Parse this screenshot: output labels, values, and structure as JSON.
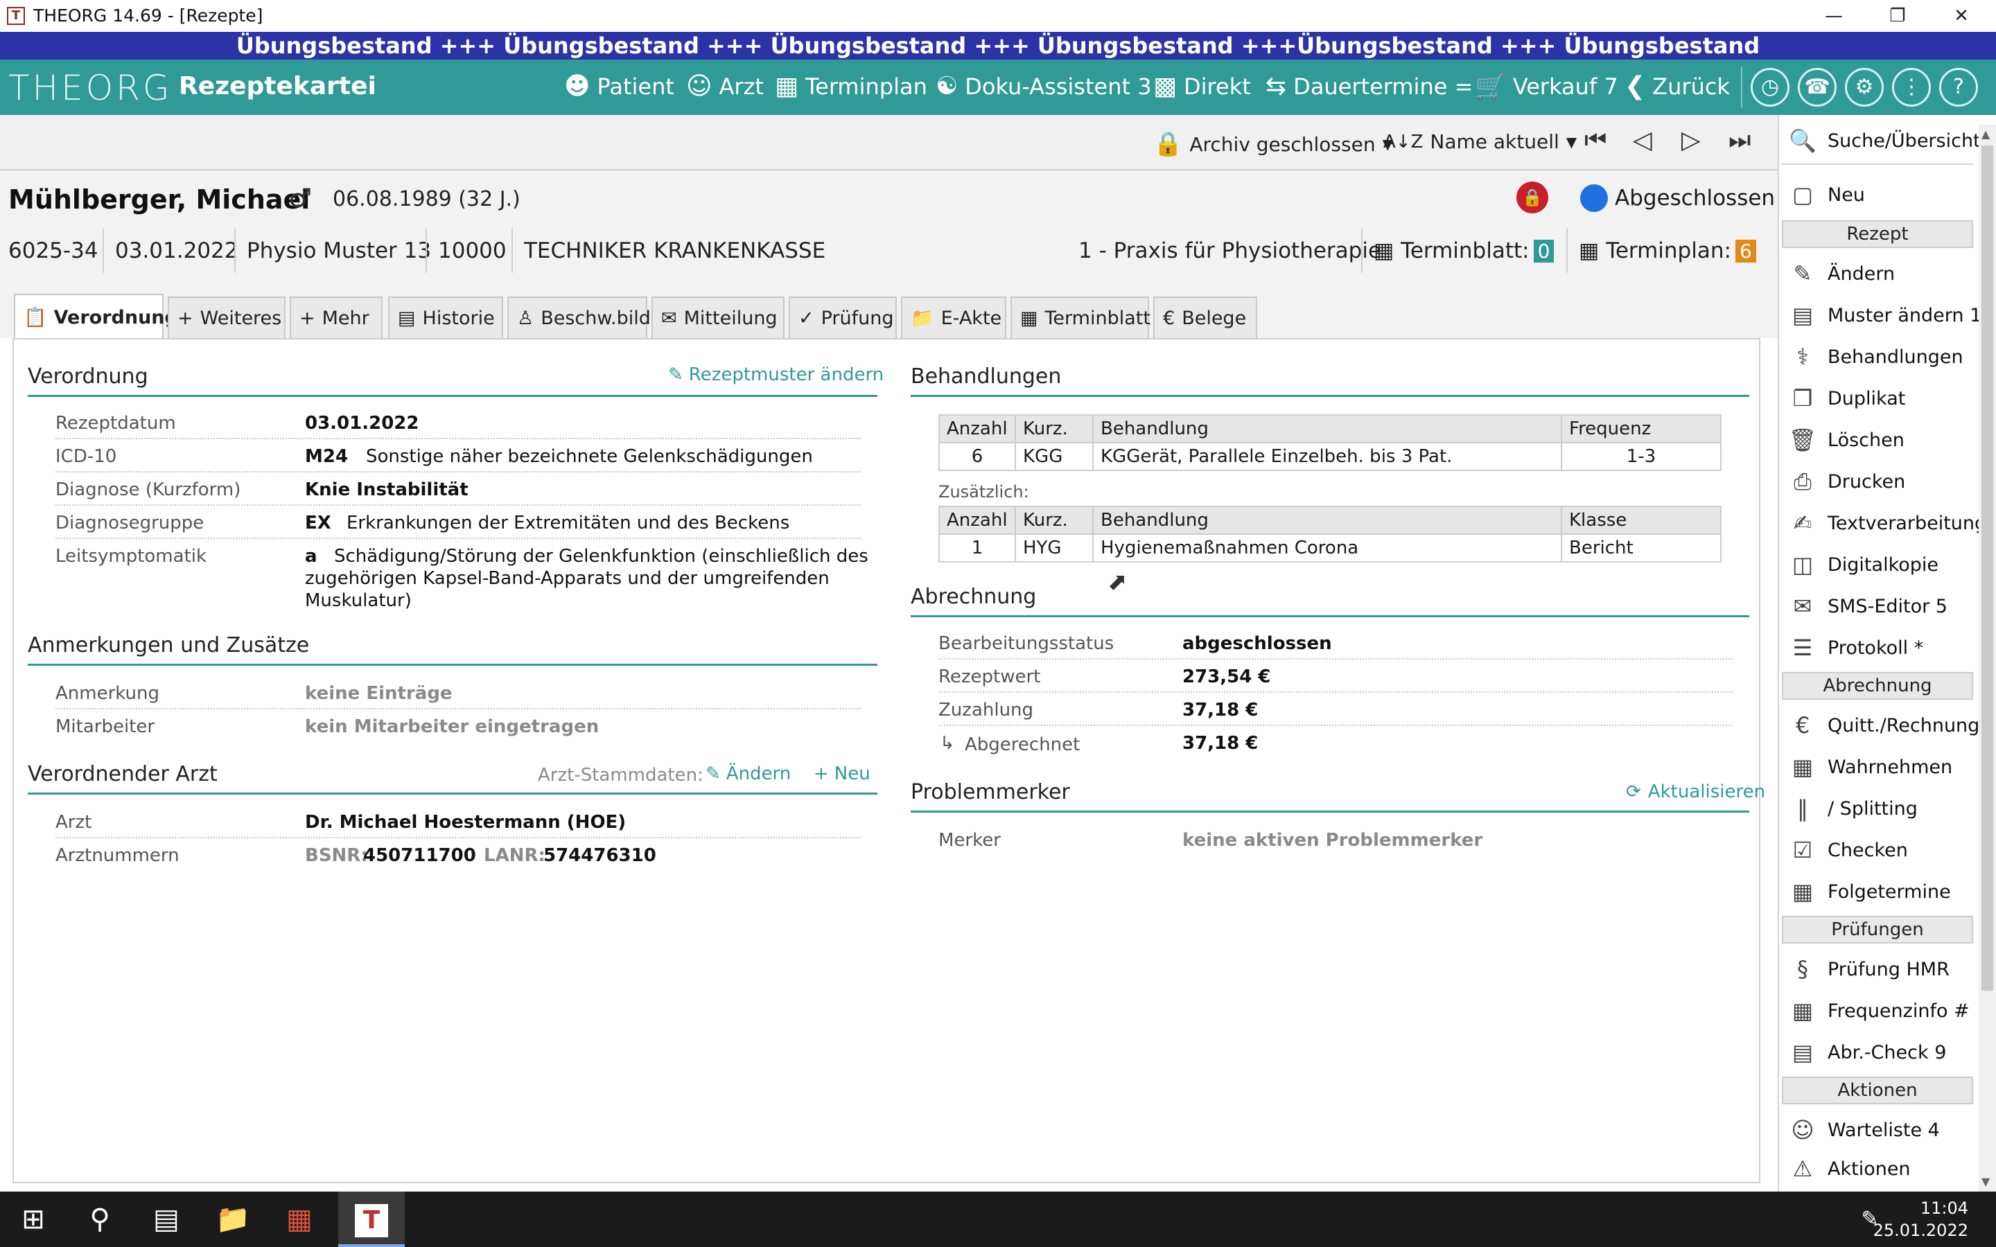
{
  "window": {
    "title": "THEORG 14.69 - [Rezepte]",
    "app_icon": "T",
    "banner": "Übungsbestand +++ Übungsbestand +++ Übungsbestand +++ Übungsbestand +++Übungsbestand +++ Übungsbestand"
  },
  "toolbar": {
    "logo": "THEORG",
    "module": "Rezeptekartei",
    "items": [
      {
        "icon": "patient-icon",
        "label": "Patient"
      },
      {
        "icon": "doctor-icon",
        "label": "Arzt"
      },
      {
        "icon": "calendar-icon",
        "label": "Terminplan"
      },
      {
        "icon": "assistant-icon",
        "label": "Doku-Assistent 3"
      },
      {
        "icon": "direct-icon",
        "label": "Direkt"
      },
      {
        "icon": "recurring-icon",
        "label": "Dauertermine ="
      },
      {
        "icon": "cart-icon",
        "label": "Verkauf 7"
      },
      {
        "icon": "back-icon",
        "label": "Zurück"
      }
    ]
  },
  "subbar": {
    "archive": "Archiv geschlossen",
    "sort": "Name aktuell"
  },
  "patient": {
    "name": "Mühlberger, Michael",
    "dob": "06.08.1989 (32 J.)",
    "status": "Abgeschlossen",
    "id": "6025-34",
    "date": "03.01.2022",
    "template": "Physio Muster 13",
    "insurer_no": "10000",
    "insurer": "TECHNIKER KRANKENKASSE",
    "practice": "1 - Praxis für Physiotherapie",
    "terminblatt_label": "Terminblatt:",
    "terminblatt_count": "0",
    "terminplan_label": "Terminplan:",
    "terminplan_count": "6"
  },
  "tabs": [
    {
      "label": "Verordnung",
      "active": true
    },
    {
      "label": "Weiteres"
    },
    {
      "label": "Mehr"
    },
    {
      "label": "Historie"
    },
    {
      "label": "Beschw.bild"
    },
    {
      "label": "Mitteilung"
    },
    {
      "label": "Prüfung"
    },
    {
      "label": "E-Akte"
    },
    {
      "label": "Terminblatt"
    },
    {
      "label": "Belege"
    }
  ],
  "verordnung": {
    "heading": "Verordnung",
    "edit_link": "Rezeptmuster ändern",
    "rows": [
      {
        "label": "Rezeptdatum",
        "code": "03.01.2022",
        "text": ""
      },
      {
        "label": "ICD-10",
        "code": "M24",
        "text": "Sonstige näher bezeichnete Gelenkschädigungen"
      },
      {
        "label": "Diagnose (Kurzform)",
        "code": "Knie Instabilität",
        "text": ""
      },
      {
        "label": "Diagnosegruppe",
        "code": "EX",
        "text": "Erkrankungen der Extremitäten und des Beckens"
      },
      {
        "label": "Leitsymptomatik",
        "code": "a",
        "text": "Schädigung/Störung der Gelenkfunktion (einschließlich des"
      }
    ],
    "leit_line2": "zugehörigen Kapsel-Band-Apparats und der umgreifenden",
    "leit_line3": "Muskulatur)"
  },
  "anmerkungen": {
    "heading": "Anmerkungen und Zusätze",
    "anmerkung_label": "Anmerkung",
    "anmerkung_value": "keine Einträge",
    "mitarbeiter_label": "Mitarbeiter",
    "mitarbeiter_value": "kein Mitarbeiter eingetragen"
  },
  "arzt": {
    "heading": "Verordnender Arzt",
    "stamm_label": "Arzt-Stammdaten:",
    "edit": "Ändern",
    "new": "Neu",
    "arzt_label": "Arzt",
    "arzt_value": "Dr. Michael Hoestermann (HOE)",
    "nr_label": "Arztnummern",
    "bsnr_label": "BSNR:",
    "bsnr": "450711700",
    "lanr_label": "LANR:",
    "lanr": "574476310"
  },
  "behandlungen": {
    "heading": "Behandlungen",
    "columns": [
      "Anzahl",
      "Kurz.",
      "Behandlung",
      "Frequenz"
    ],
    "rows": [
      [
        "6",
        "KGG",
        "KGGerät, Parallele Einzelbeh. bis 3 Pat.",
        "1-3"
      ]
    ],
    "extra_label": "Zusätzlich:",
    "extra_columns": [
      "Anzahl",
      "Kurz.",
      "Behandlung",
      "Klasse"
    ],
    "extra_rows": [
      [
        "1",
        "HYG",
        "Hygienemaßnahmen Corona",
        "Bericht"
      ]
    ]
  },
  "abrechnung": {
    "heading": "Abrechnung",
    "rows": [
      {
        "label": "Bearbeitungsstatus",
        "value": "abgeschlossen"
      },
      {
        "label": "Rezeptwert",
        "value": "273,54 €"
      },
      {
        "label": "Zuzahlung",
        "value": "37,18 €"
      },
      {
        "label": "Abgerechnet",
        "value": "37,18 €"
      }
    ]
  },
  "problemmerker": {
    "heading": "Problemmerker",
    "refresh": "Aktualisieren",
    "label": "Merker",
    "value": "keine aktiven Problemmerker"
  },
  "sidebar": {
    "search": "Suche/Übersicht",
    "new": "Neu",
    "groups": {
      "rezept": "Rezept",
      "abrechnung": "Abrechnung",
      "pruefungen": "Prüfungen",
      "aktionen": "Aktionen"
    },
    "rezept_items": [
      "Ändern",
      "Muster ändern 1",
      "Behandlungen",
      "Duplikat",
      "Löschen",
      "Drucken",
      "Textverarbeitung",
      "Digitalkopie",
      "SMS-Editor 5",
      "Protokoll *"
    ],
    "abrechnung_items": [
      "Quitt./Rechnung",
      "Wahrnehmen",
      "/ Splitting",
      "Checken",
      "Folgetermine"
    ],
    "pruefungen_items": [
      "Prüfung HMR",
      "Frequenzinfo #",
      "Abr.-Check 9"
    ],
    "aktionen_items": [
      "Warteliste 4",
      "Aktionen"
    ]
  },
  "taskbar": {
    "time": "11:04",
    "date": "25.01.2022"
  },
  "colors": {
    "banner": "#2b33a6",
    "toolbar": "#2f9a96",
    "accent": "#2f9a96",
    "status_blue": "#1f6fe0",
    "lock_red": "#c8202a",
    "badge_teal": "#2f9a96",
    "badge_orange": "#e08a1a"
  }
}
